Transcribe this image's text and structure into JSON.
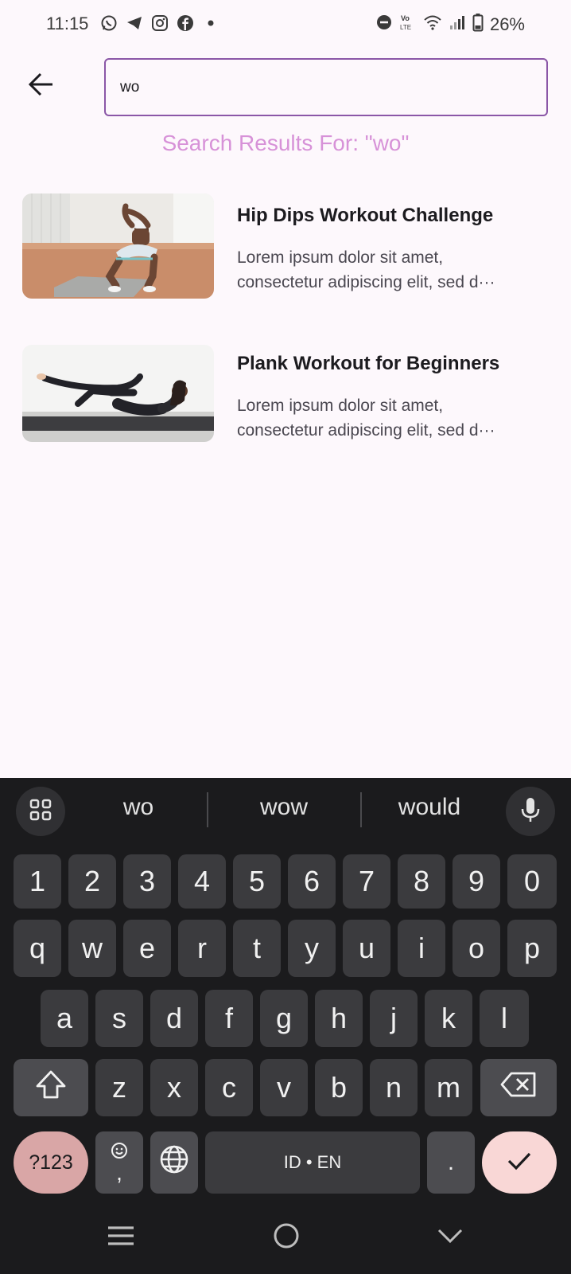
{
  "status_bar": {
    "time": "11:15",
    "app_icons": [
      "whatsapp-icon",
      "telegram-icon",
      "instagram-icon",
      "facebook-icon",
      "dot-icon"
    ],
    "right_icons": [
      "dnd-icon",
      "volte-icon",
      "wifi-icon",
      "signal-icon",
      "battery-icon"
    ],
    "battery": "26%"
  },
  "search": {
    "value": "wo",
    "results_heading": "Search Results For: \"wo\""
  },
  "results": [
    {
      "title": "Hip Dips Workout Challenge",
      "desc_line1": "Lorem ipsum dolor sit amet,",
      "desc_line2": "consectetur adipiscing elit, sed d···"
    },
    {
      "title": "Plank Workout for Beginners",
      "desc_line1": "Lorem ipsum dolor sit amet,",
      "desc_line2": "consectetur adipiscing elit, sed d···"
    }
  ],
  "keyboard": {
    "suggestions": [
      "wo",
      "wow",
      "would"
    ],
    "row_numbers": [
      "1",
      "2",
      "3",
      "4",
      "5",
      "6",
      "7",
      "8",
      "9",
      "0"
    ],
    "row1": [
      "q",
      "w",
      "e",
      "r",
      "t",
      "y",
      "u",
      "i",
      "o",
      "p"
    ],
    "row2": [
      "a",
      "s",
      "d",
      "f",
      "g",
      "h",
      "j",
      "k",
      "l"
    ],
    "row3": [
      "z",
      "x",
      "c",
      "v",
      "b",
      "n",
      "m"
    ],
    "symbols_label": "?123",
    "comma_label": ",",
    "space_label": "ID • EN",
    "period_label": "."
  },
  "colors": {
    "accent": "#8b57a7",
    "heading": "#d792d8",
    "keyboard_bg": "#1b1b1d",
    "enter_key": "#f9d7d6",
    "symbols_key": "#d9a6a6"
  }
}
